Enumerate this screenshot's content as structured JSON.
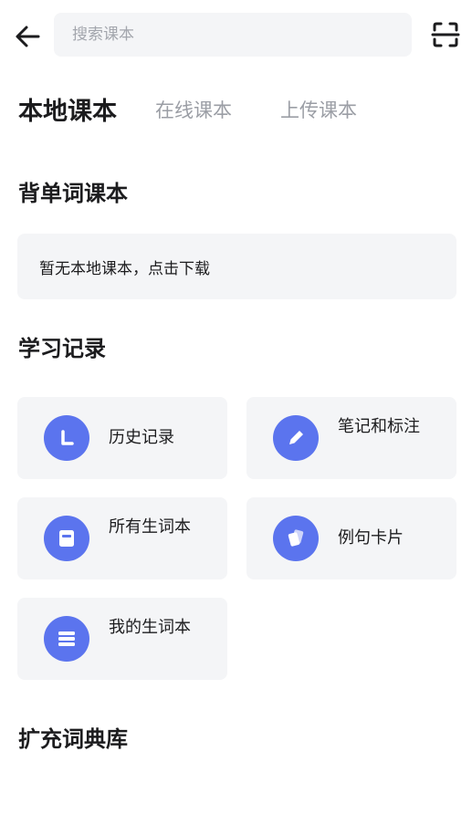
{
  "header": {
    "back_icon": "arrow-left-icon",
    "search_placeholder": "搜索课本",
    "scan_icon": "scan-icon"
  },
  "tabs": [
    {
      "label": "本地课本",
      "active": true
    },
    {
      "label": "在线课本",
      "active": false
    },
    {
      "label": "上传课本",
      "active": false
    }
  ],
  "sections": {
    "vocab_books": {
      "title": "背单词课本",
      "empty_text": "暂无本地课本，点击下载"
    },
    "study_records": {
      "title": "学习记录",
      "items": [
        {
          "label": "历史记录",
          "icon": "clock-icon"
        },
        {
          "label": "笔记和标注",
          "icon": "pencil-icon"
        },
        {
          "label": "所有生词本",
          "icon": "notebook-icon"
        },
        {
          "label": "例句卡片",
          "icon": "cards-icon"
        },
        {
          "label": "我的生词本",
          "icon": "list-icon"
        }
      ]
    },
    "dictionaries": {
      "title": "扩充词典库"
    }
  },
  "colors": {
    "accent": "#5b74ee",
    "card_bg": "#f4f5f7",
    "inactive_tab": "#9b9ea5"
  }
}
